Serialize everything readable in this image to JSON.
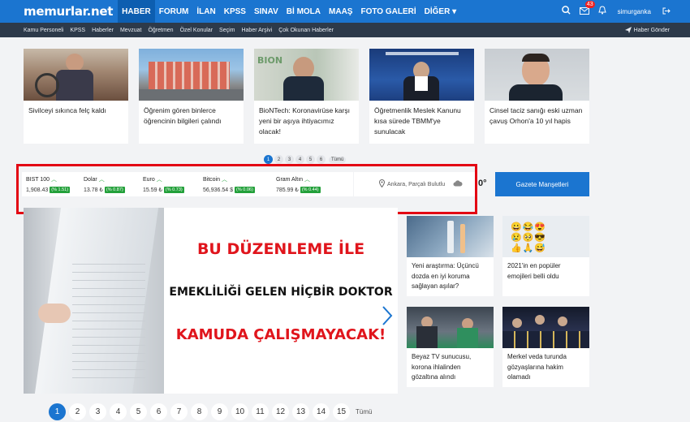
{
  "header": {
    "logo": "memurlar.net",
    "nav": [
      "HABER",
      "FORUM",
      "İLAN",
      "KPSS",
      "SINAV",
      "Bİ MOLA",
      "MAAŞ",
      "FOTO GALERİ",
      "DİĞER ▾"
    ],
    "active_nav": "HABER",
    "mail_badge": "43",
    "username": "simurganka"
  },
  "subnav": {
    "items": [
      "Kamu Personeli",
      "KPSS",
      "Haberler",
      "Mevzuat",
      "Öğretmen",
      "Özel Konular",
      "Seçim",
      "Haber Arşivi",
      "Çok Okunan Haberler"
    ],
    "send_news": "Haber Gönder"
  },
  "top_news": [
    {
      "title": "Sivilceyi sıkınca felç kaldı"
    },
    {
      "title": "Öğrenim gören binlerce öğrencinin bilgileri çalındı"
    },
    {
      "title": "BioNTech: Koronavirüse karşı yeni bir aşıya ihtiyacımız olacak!"
    },
    {
      "title": "Öğretmenlik Meslek Kanunu kısa sürede TBMM'ye sunulacak"
    },
    {
      "title": "Cinsel taciz sanığı eski uzman çavuş Orhon'a 10 yıl hapis"
    }
  ],
  "top_pager": {
    "pages": [
      "1",
      "2",
      "3",
      "4",
      "5",
      "6"
    ],
    "all": "Tümü",
    "active": "1"
  },
  "market": [
    {
      "name": "BIST 100",
      "value": "1,908.43",
      "change": "(% 1.51)"
    },
    {
      "name": "Dolar",
      "value": "13.78 ₺",
      "change": "(% 0.87)"
    },
    {
      "name": "Euro",
      "value": "15.59 ₺",
      "change": "(% 0.73)"
    },
    {
      "name": "Bitcoin",
      "value": "56,936.54 $",
      "change": "(% 0.06)"
    },
    {
      "name": "Gram Altın",
      "value": "785.99 ₺",
      "change": "(% 0.44)"
    }
  ],
  "weather": {
    "location": "Ankara, Parçalı Bulutlu",
    "temp": "0°"
  },
  "gazete_button": "Gazete Manşetleri",
  "slider": {
    "line1": "BU DÜZENLEME İLE",
    "line2": "EMEKLİLİĞİ GELEN HİÇBİR DOKTOR",
    "line3": "KAMUDA ÇALIŞMAYACAK!"
  },
  "bottom_pager": {
    "pages": [
      "1",
      "2",
      "3",
      "4",
      "5",
      "6",
      "7",
      "8",
      "9",
      "10",
      "11",
      "12",
      "13",
      "14",
      "15"
    ],
    "all": "Tümü",
    "active": "1"
  },
  "right_news": [
    {
      "title": "Yeni araştırma: Üçüncü dozda en iyi koruma sağlayan aşılar?"
    },
    {
      "title": "2021'in en popüler emojileri belli oldu"
    },
    {
      "title": "Beyaz TV sunucusu, korona ihlalinden gözaltına alındı"
    },
    {
      "title": "Merkel veda turunda gözyaşlarına hakim olamadı"
    }
  ],
  "colors": {
    "brand": "#1b75d0",
    "subnav": "#2d3a4a",
    "up": "#23a03a",
    "highlight": "#e30613"
  }
}
